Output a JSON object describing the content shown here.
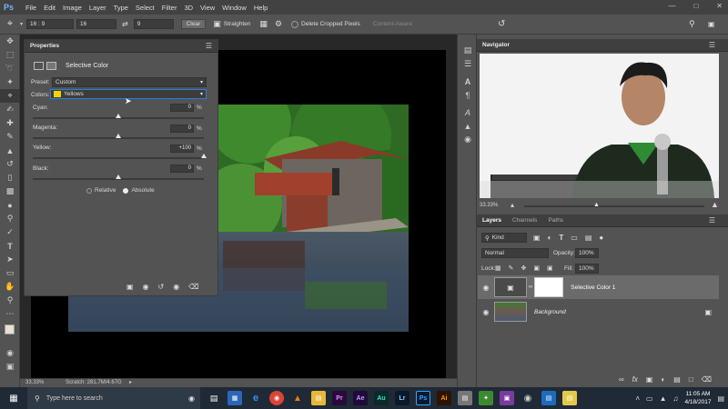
{
  "app": {
    "logo": "Ps"
  },
  "menu": [
    "File",
    "Edit",
    "Image",
    "Layer",
    "Type",
    "Select",
    "Filter",
    "3D",
    "View",
    "Window",
    "Help"
  ],
  "options": {
    "ratio": "16 : 9",
    "width": "16",
    "height": "9",
    "clear_label": "Clear",
    "straighten_label": "Straighten",
    "delete_cropped_label": "Delete Cropped Pixels",
    "content_aware_label": "Content-Aware"
  },
  "properties": {
    "tab_title": "Properties",
    "adjustment_title": "Selective Color",
    "preset_label": "Preset:",
    "preset_value": "Custom",
    "colors_label": "Colors:",
    "colors_value": "Yellows",
    "sliders": [
      {
        "label": "Cyan:",
        "value": "0",
        "unit": "%",
        "pos": 0.5
      },
      {
        "label": "Magenta:",
        "value": "0",
        "unit": "%",
        "pos": 0.5
      },
      {
        "label": "Yellow:",
        "value": "+100",
        "unit": "%",
        "pos": 1.0
      },
      {
        "label": "Black:",
        "value": "0",
        "unit": "%",
        "pos": 0.5
      }
    ],
    "relative_label": "Relative",
    "absolute_label": "Absolute"
  },
  "status": {
    "zoom": "33.33%",
    "scratch": "Scratch: 281.7M/4.67G"
  },
  "navigator": {
    "tab_title": "Navigator",
    "zoom": "33.33%"
  },
  "layers": {
    "tabs": [
      "Layers",
      "Channels",
      "Paths"
    ],
    "kind_label": "Kind",
    "blend_mode": "Normal",
    "opacity_label": "Opacity:",
    "opacity_value": "100%",
    "lock_label": "Lock:",
    "fill_label": "Fill:",
    "fill_value": "100%",
    "items": [
      {
        "name": "Selective Color 1"
      },
      {
        "name": "Background"
      }
    ]
  },
  "taskbar": {
    "search_placeholder": "Type here to search",
    "time": "11:05 AM",
    "date": "4/18/2017",
    "apps": [
      "Pr",
      "Ae",
      "Au",
      "Lr",
      "Ps",
      "Ai"
    ]
  },
  "colors": {
    "ps_blue": "#31a8ff",
    "accent": "#1473e6"
  }
}
